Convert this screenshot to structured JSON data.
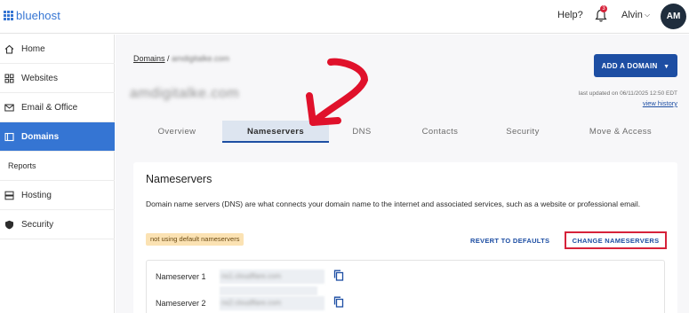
{
  "header": {
    "brand": "bluehost",
    "help_label": "Help?",
    "notification_count": "3",
    "user_name": "Alvin",
    "avatar_initials": "AM"
  },
  "sidebar": {
    "items": [
      {
        "label": "Home",
        "icon": "home-icon"
      },
      {
        "label": "Websites",
        "icon": "grid-icon"
      },
      {
        "label": "Email & Office",
        "icon": "mail-icon"
      },
      {
        "label": "Domains",
        "icon": "domains-icon",
        "active": true
      },
      {
        "label": "Reports"
      },
      {
        "label": "Hosting",
        "icon": "server-icon"
      },
      {
        "label": "Security",
        "icon": "shield-icon"
      }
    ]
  },
  "main": {
    "breadcrumb_root": "Domains",
    "breadcrumb_separator": " / ",
    "breadcrumb_current": "amdigitalke.com",
    "domain_title": "amdigitalke.com",
    "add_domain_label": "ADD A DOMAIN",
    "last_updated": "last updated on 06/11/2025 12:50 EDT",
    "view_history": "view history",
    "tabs": [
      {
        "label": "Overview"
      },
      {
        "label": "Nameservers",
        "active": true
      },
      {
        "label": "DNS"
      },
      {
        "label": "Contacts"
      },
      {
        "label": "Security"
      },
      {
        "label": "Move & Access"
      }
    ]
  },
  "nameservers_card": {
    "title": "Nameservers",
    "description": "Domain name servers (DNS) are what connects your domain name to the internet and associated services, such as a website or professional email.",
    "status_badge": "not using default nameservers",
    "revert_label": "REVERT TO DEFAULTS",
    "change_label": "CHANGE NAMESERVERS",
    "rows": [
      {
        "label": "Nameserver 1",
        "value": "ns1.cloudflare.com"
      },
      {
        "label": "Nameserver 2",
        "value": "ns2.cloudflare.com"
      }
    ]
  },
  "colors": {
    "brand": "#3575d3",
    "primary_button": "#1d4ea3",
    "highlight_outline": "#d6223a",
    "annotation_arrow": "#e0112b",
    "badge_bg": "#fbe2b3"
  }
}
